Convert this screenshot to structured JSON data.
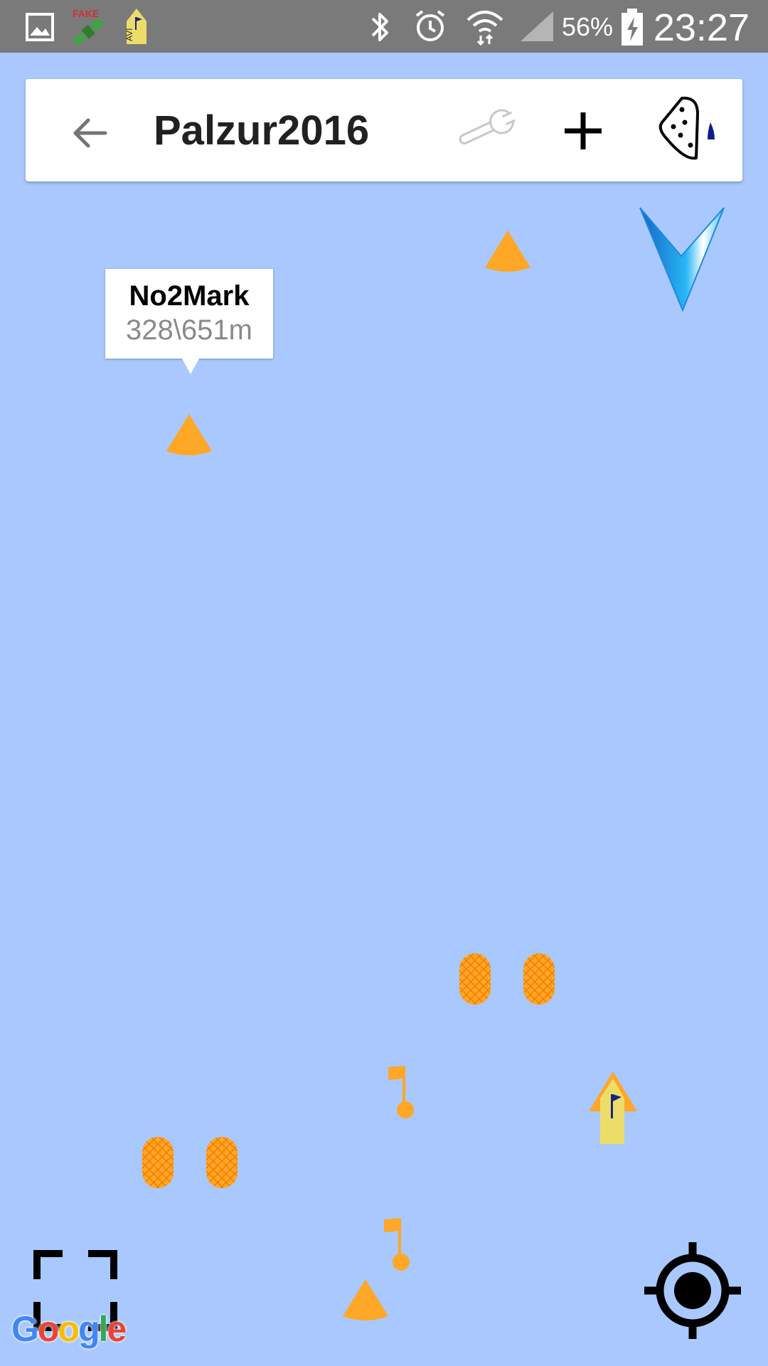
{
  "status_bar": {
    "time": "23:27",
    "battery_percent": "56%",
    "notification_icons": [
      "gallery-icon",
      "fake-gps-icon",
      "avi-app-icon"
    ],
    "fake_label": "FAKE",
    "avi_label": "AVI",
    "system_icons": [
      "bluetooth-icon",
      "alarm-icon",
      "wifi-icon",
      "signal-icon",
      "battery-charging-icon"
    ]
  },
  "toolbar": {
    "title": "Palzur2016",
    "back_icon": "arrow-left-icon",
    "settings_icon": "wrench-icon",
    "add_icon": "plus-icon",
    "course_icon": "sail-course-icon"
  },
  "info_window": {
    "title": "No2Mark",
    "subtitle": "328\\651m"
  },
  "map": {
    "background_color": "#a9c8fd",
    "marker_color": "#ffa726",
    "boat_color": "#ecdd6b",
    "compass_icon": "direction-arrow-icon",
    "markers": [
      {
        "type": "mark-buoy",
        "icon": "cone-buoy-icon"
      },
      {
        "type": "mark-buoy",
        "icon": "cone-buoy-icon",
        "label": "No2Mark"
      },
      {
        "type": "gate-buoy",
        "icon": "barrel-buoy-icon"
      },
      {
        "type": "gate-buoy",
        "icon": "barrel-buoy-icon"
      },
      {
        "type": "flag-buoy",
        "icon": "flag-buoy-icon"
      },
      {
        "type": "boat",
        "icon": "boat-icon"
      },
      {
        "type": "gate-buoy",
        "icon": "barrel-buoy-icon"
      },
      {
        "type": "gate-buoy",
        "icon": "barrel-buoy-icon"
      },
      {
        "type": "flag-buoy",
        "icon": "flag-buoy-icon"
      },
      {
        "type": "mark-buoy",
        "icon": "cone-buoy-icon"
      }
    ]
  },
  "controls": {
    "fullscreen_icon": "fullscreen-icon",
    "my_location_icon": "my-location-icon"
  },
  "attribution": {
    "letters": [
      "G",
      "o",
      "o",
      "g",
      "l",
      "e"
    ],
    "colors": [
      "#4285f4",
      "#ea4335",
      "#fbbc05",
      "#4285f4",
      "#34a853",
      "#ea4335"
    ]
  }
}
